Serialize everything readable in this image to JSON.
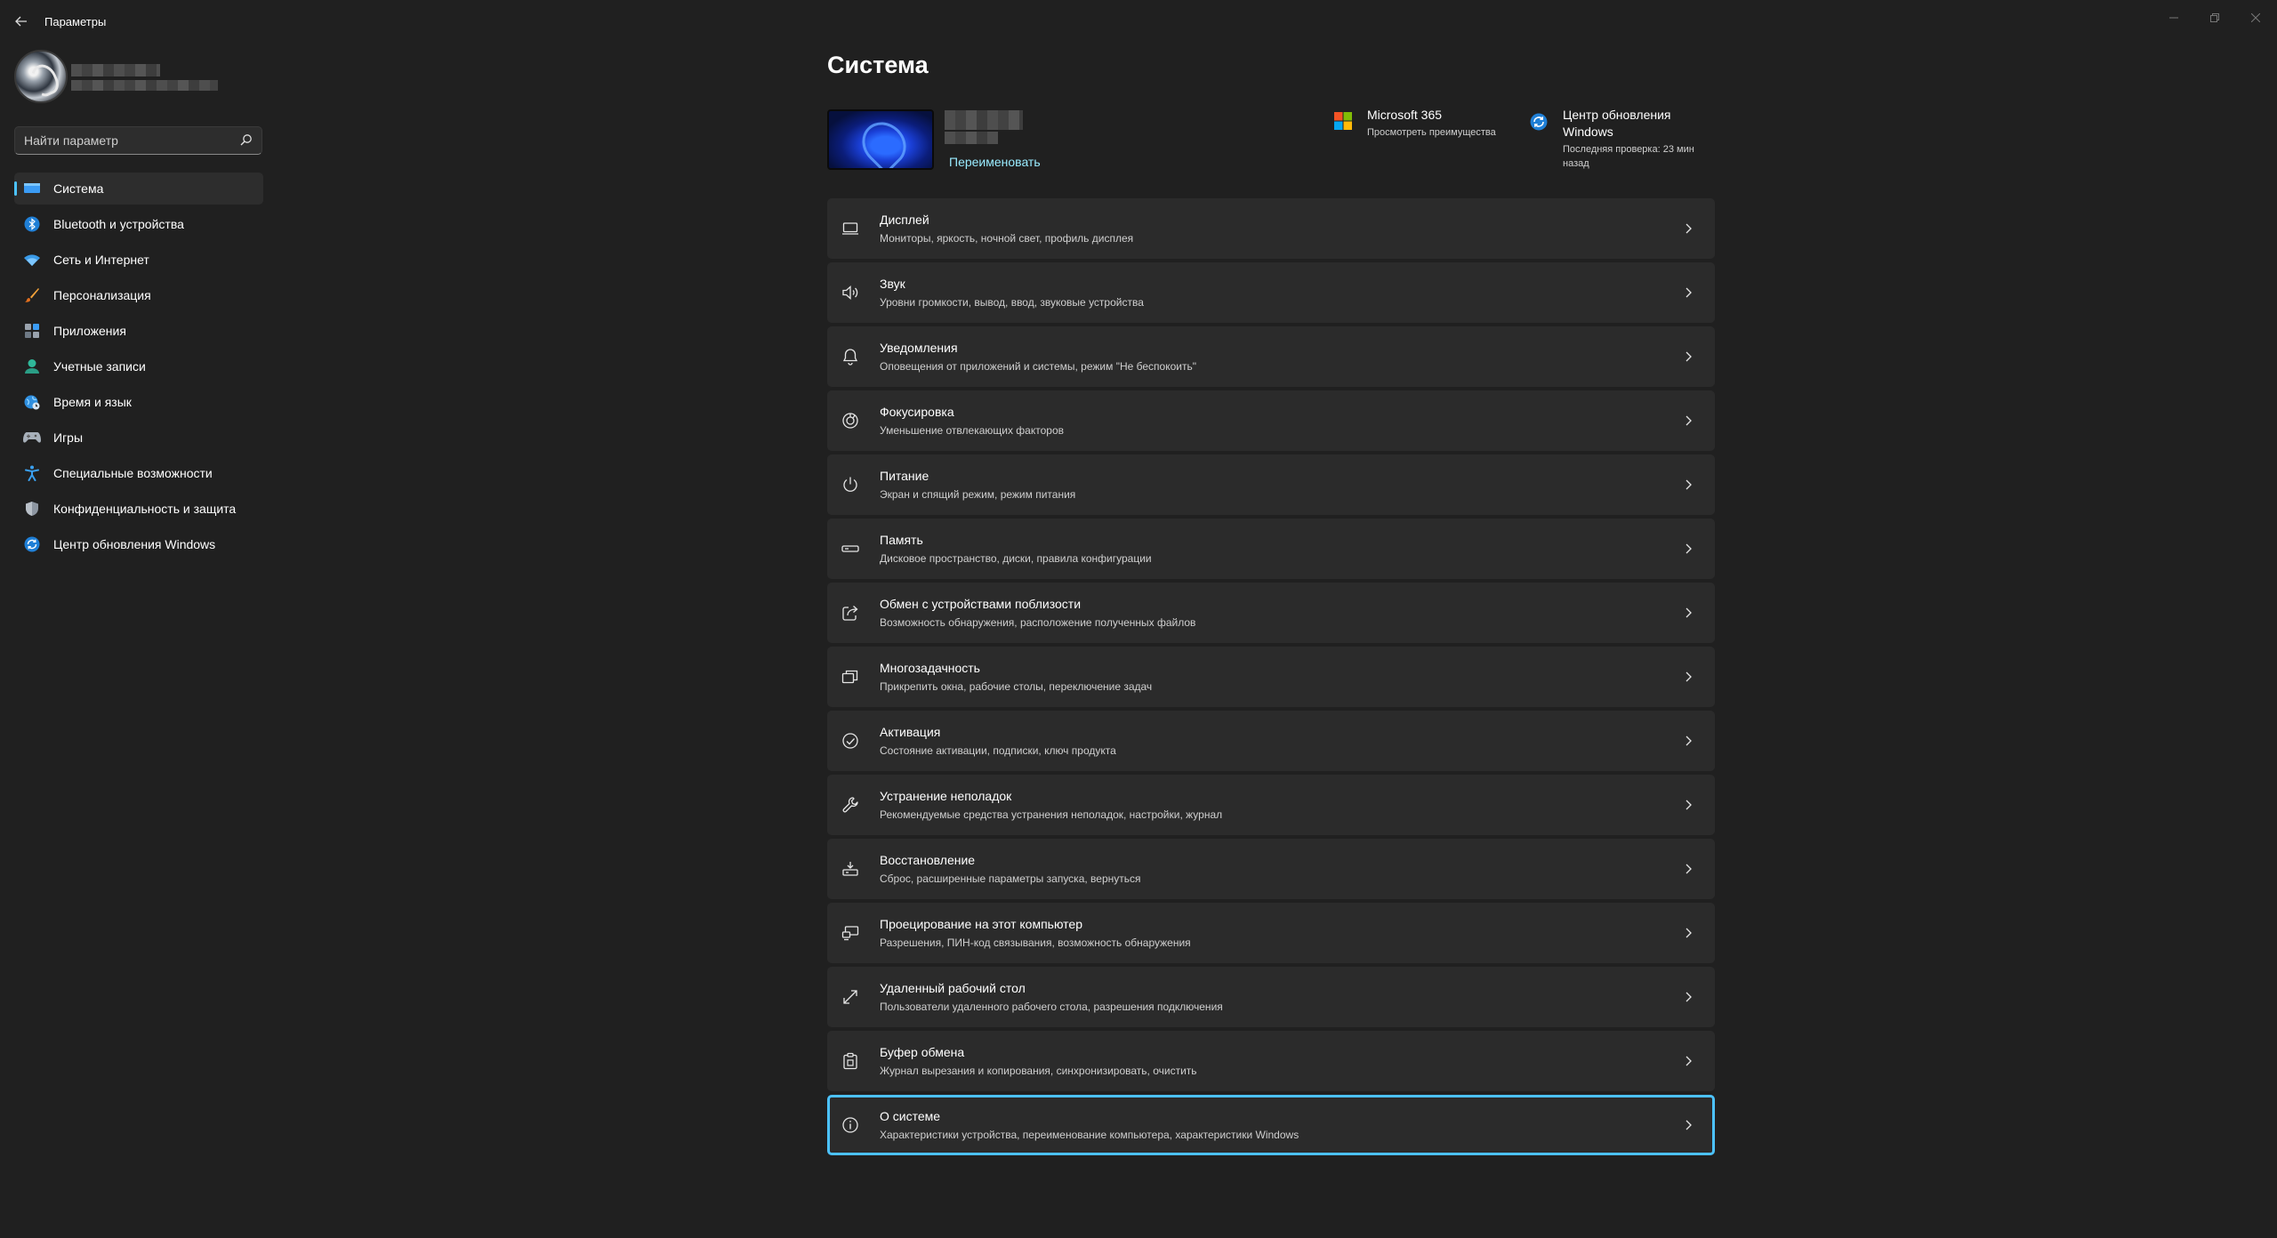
{
  "window": {
    "title": "Параметры",
    "back_icon": "arrow-left-icon",
    "controls": [
      "minimize-icon",
      "maximize-icon",
      "close-icon"
    ]
  },
  "sidebar": {
    "search": {
      "placeholder": "Найти параметр",
      "value": "",
      "icon": "search-icon"
    },
    "items": [
      {
        "label": "Система",
        "icon": "monitor-icon",
        "active": true
      },
      {
        "label": "Bluetooth и устройства",
        "icon": "bluetooth-icon"
      },
      {
        "label": "Сеть и Интернет",
        "icon": "wifi-icon"
      },
      {
        "label": "Персонализация",
        "icon": "brush-icon"
      },
      {
        "label": "Приложения",
        "icon": "apps-icon"
      },
      {
        "label": "Учетные записи",
        "icon": "person-icon"
      },
      {
        "label": "Время и язык",
        "icon": "globe-clock-icon"
      },
      {
        "label": "Игры",
        "icon": "gamepad-icon"
      },
      {
        "label": "Специальные возможности",
        "icon": "accessibility-icon"
      },
      {
        "label": "Конфиденциальность и защита",
        "icon": "shield-icon"
      },
      {
        "label": "Центр обновления Windows",
        "icon": "sync-icon"
      }
    ]
  },
  "main": {
    "title": "Система",
    "device": {
      "rename_label": "Переименовать"
    },
    "promos": [
      {
        "title": "Microsoft 365",
        "subtitle": "Просмотреть преимущества",
        "icon": "microsoft-logo-icon"
      },
      {
        "title": "Центр обновления Windows",
        "subtitle": "Последняя проверка: 23 мин назад",
        "icon": "sync-icon"
      }
    ],
    "settings": [
      {
        "title": "Дисплей",
        "subtitle": "Мониторы, яркость, ночной свет, профиль дисплея",
        "icon": "display-icon"
      },
      {
        "title": "Звук",
        "subtitle": "Уровни громкости, вывод, ввод, звуковые устройства",
        "icon": "speaker-icon"
      },
      {
        "title": "Уведомления",
        "subtitle": "Оповещения от приложений и системы, режим \"Не беспокоить\"",
        "icon": "bell-icon"
      },
      {
        "title": "Фокусировка",
        "subtitle": "Уменьшение отвлекающих факторов",
        "icon": "focus-icon"
      },
      {
        "title": "Питание",
        "subtitle": "Экран и спящий режим, режим питания",
        "icon": "power-icon"
      },
      {
        "title": "Память",
        "subtitle": "Дисковое пространство, диски, правила конфигурации",
        "icon": "storage-icon"
      },
      {
        "title": "Обмен с устройствами поблизости",
        "subtitle": "Возможность обнаружения, расположение полученных файлов",
        "icon": "share-icon"
      },
      {
        "title": "Многозадачность",
        "subtitle": "Прикрепить окна, рабочие столы, переключение задач",
        "icon": "multitask-icon"
      },
      {
        "title": "Активация",
        "subtitle": "Состояние активации, подписки, ключ продукта",
        "icon": "check-circle-icon"
      },
      {
        "title": "Устранение неполадок",
        "subtitle": "Рекомендуемые средства устранения неполадок, настройки, журнал",
        "icon": "wrench-icon"
      },
      {
        "title": "Восстановление",
        "subtitle": "Сброс, расширенные параметры запуска, вернуться",
        "icon": "recovery-icon"
      },
      {
        "title": "Проецирование на этот компьютер",
        "subtitle": "Разрешения, ПИН-код связывания, возможность обнаружения",
        "icon": "projection-icon"
      },
      {
        "title": "Удаленный рабочий стол",
        "subtitle": "Пользователи удаленного рабочего стола, разрешения подключения",
        "icon": "remote-desktop-icon"
      },
      {
        "title": "Буфер обмена",
        "subtitle": "Журнал вырезания и копирования, синхронизировать, очистить",
        "icon": "clipboard-icon"
      },
      {
        "title": "О системе",
        "subtitle": "Характеристики устройства, переименование компьютера, характеристики Windows",
        "icon": "info-icon",
        "focused": true
      }
    ]
  },
  "colors": {
    "background": "#202020",
    "card": "#2b2b2b",
    "accent": "#4cc2ff",
    "link": "#99ebff"
  }
}
